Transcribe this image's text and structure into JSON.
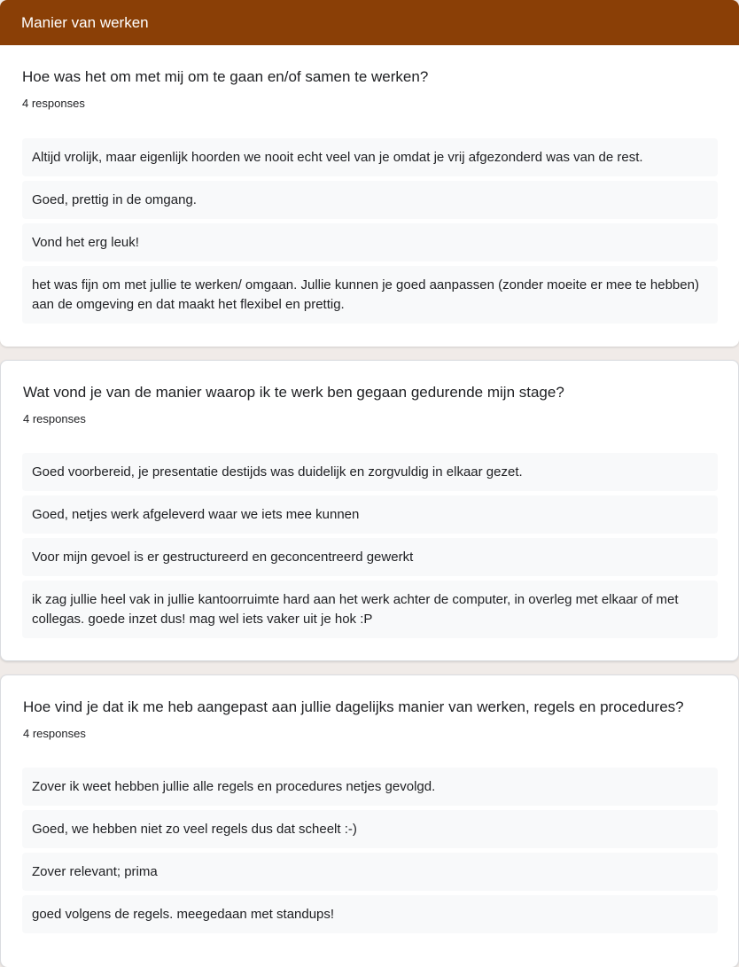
{
  "section": {
    "title": "Manier van werken"
  },
  "questions": [
    {
      "title": "Hoe was het om met mij om te gaan en/of samen te werken?",
      "count": "4 responses",
      "responses": [
        "Altijd vrolijk, maar eigenlijk hoorden we nooit echt veel van je omdat je vrij afgezonderd was van de rest.",
        "Goed, prettig in de omgang.",
        "Vond het erg leuk!",
        "het was fijn om met jullie te werken/ omgaan. Jullie kunnen je goed aanpassen (zonder moeite er mee te hebben) aan de omgeving en dat maakt het flexibel en prettig."
      ]
    },
    {
      "title": "Wat vond je van de manier waarop ik te werk ben gegaan gedurende mijn stage?",
      "count": "4 responses",
      "responses": [
        "Goed voorbereid, je presentatie destijds was duidelijk en zorgvuldig in elkaar gezet.",
        "Goed, netjes werk afgeleverd waar we iets mee kunnen",
        "Voor mijn gevoel is er gestructureerd en geconcentreerd gewerkt",
        "ik zag jullie heel vak in jullie kantoorruimte hard aan het werk achter de computer, in overleg met elkaar of met collegas. goede inzet dus! mag wel iets vaker uit je hok :P"
      ]
    },
    {
      "title": "Hoe vind je dat ik me heb aangepast aan jullie dagelijks manier van werken, regels en procedures?",
      "count": "4 responses",
      "responses": [
        "Zover ik weet hebben jullie alle regels en procedures netjes gevolgd.",
        "Goed, we hebben niet zo veel regels dus dat scheelt :-)",
        "Zover relevant; prima",
        "goed volgens de regels. meegedaan met standups!"
      ]
    }
  ]
}
